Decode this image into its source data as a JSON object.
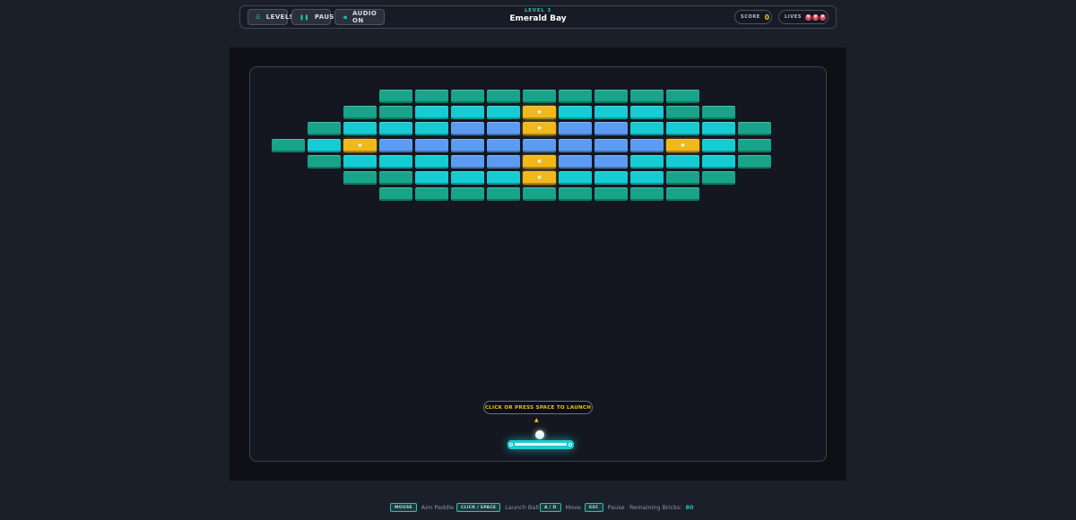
{
  "hud": {
    "levels_label": "LEVELS",
    "pause_label": "PAUSE",
    "audio_label": "AUDIO ON",
    "level_label": "LEVEL 3",
    "level_name": "Emerald Bay",
    "score_label": "SCORE",
    "score_value": "0",
    "lives_label": "LIVES",
    "lives_count": 3
  },
  "colors": {
    "accent": "#1fc7b7",
    "gold": "#f5c318",
    "green": "#17a48a",
    "cyan": "#14ccd2",
    "blue": "#5b9cf2",
    "heart": "#e44a5c"
  },
  "bricks": {
    "rows": [
      [
        null,
        null,
        null,
        "g",
        "g",
        "g",
        "g",
        "g",
        "g",
        "g",
        "g",
        "g",
        null,
        null
      ],
      [
        null,
        null,
        "g",
        "g",
        "c",
        "c",
        "c",
        "s",
        "c",
        "c",
        "c",
        "g",
        "g",
        null
      ],
      [
        null,
        "g",
        "c",
        "c",
        "c",
        "b",
        "b",
        "s",
        "b",
        "b",
        "c",
        "c",
        "c",
        "g"
      ],
      [
        "g",
        "c",
        "s",
        "b",
        "b",
        "b",
        "b",
        "b",
        "b",
        "b",
        "b",
        "s",
        "c",
        "g"
      ],
      [
        null,
        "g",
        "c",
        "c",
        "c",
        "b",
        "b",
        "s",
        "b",
        "b",
        "c",
        "c",
        "c",
        "g"
      ],
      [
        null,
        null,
        "g",
        "g",
        "c",
        "c",
        "c",
        "s",
        "c",
        "c",
        "c",
        "g",
        "g",
        null
      ],
      [
        null,
        null,
        null,
        "g",
        "g",
        "g",
        "g",
        "g",
        "g",
        "g",
        "g",
        "g",
        null,
        null
      ]
    ],
    "star_glyph": "★"
  },
  "launch_tip": "CLICK OR PRESS SPACE TO LAUNCH",
  "aim_arrow": "▲",
  "help": {
    "items": [
      {
        "key": "MOUSE",
        "text": "Aim Paddle"
      },
      {
        "key": "CLICK / SPACE",
        "text": "Launch Ball"
      },
      {
        "key": "A / D",
        "text": "Move"
      },
      {
        "key": "ESC",
        "text": "Pause"
      }
    ],
    "remaining_label": "Remaining Bricks:",
    "remaining_value": "80"
  }
}
